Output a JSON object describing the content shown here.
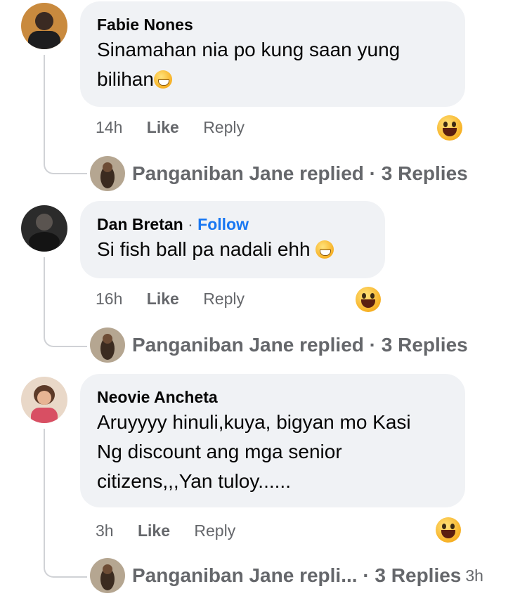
{
  "comments": [
    {
      "author": "Fabie Nones",
      "text_line1": "Sinamahan nia po kung saan yung",
      "text_line2": "bilihan",
      "time": "14h",
      "like": "Like",
      "reply": "Reply",
      "replies_summary": "Panganiban Jane replied · 3 Replies"
    },
    {
      "author": "Dan Bretan",
      "follow": "Follow",
      "separator": "·",
      "text_line1": "Si fish ball pa nadali ehh",
      "time": "16h",
      "like": "Like",
      "reply": "Reply",
      "replies_summary": "Panganiban Jane replied · 3 Replies"
    },
    {
      "author": "Neovie Ancheta",
      "text_line1": "Aruyyyy hinuli,kuya, bigyan mo Kasi",
      "text_line2": "Ng discount ang mga senior",
      "text_line3": "citizens,,,Yan tuloy......",
      "time": "3h",
      "like": "Like",
      "reply": "Reply",
      "replies_summary": "Panganiban Jane repli...  · 3 Replies",
      "reply_time": "3h"
    }
  ],
  "icons": {
    "reaction": "haha-reaction-icon",
    "inline_emoji": "grin-emoji-icon"
  }
}
